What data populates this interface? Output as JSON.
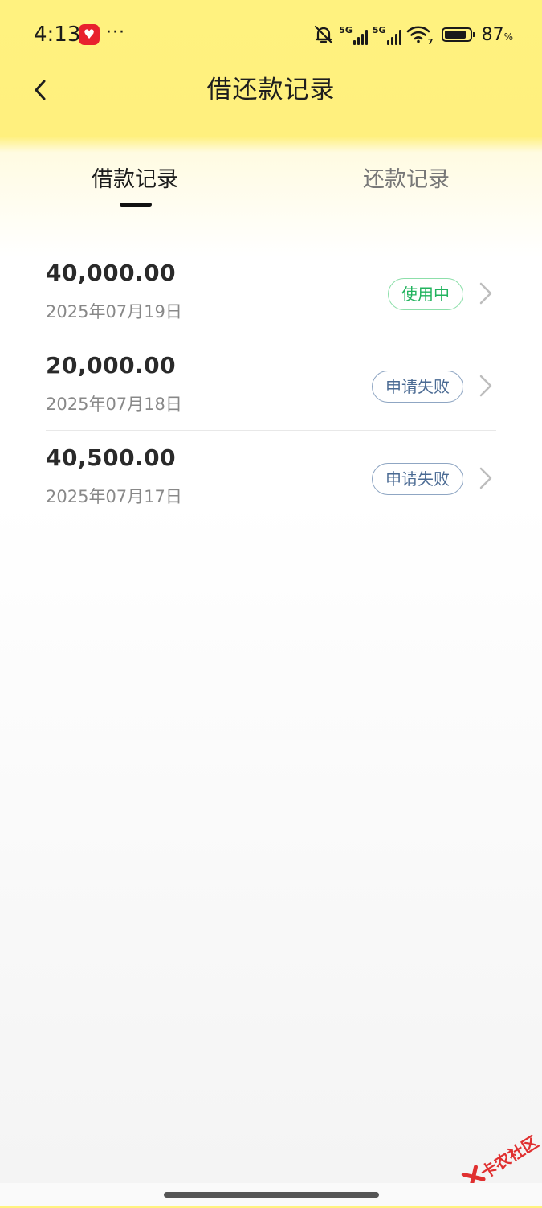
{
  "status_bar": {
    "time": "4:13",
    "dots": "···",
    "network_1": "5G",
    "network_2": "5G",
    "wifi_sub": "7",
    "battery_value": "87",
    "battery_unit": "%",
    "battery_level": 0.87
  },
  "header": {
    "title": "借还款记录"
  },
  "tabs": [
    {
      "label": "借款记录",
      "active": true
    },
    {
      "label": "还款记录",
      "active": false
    }
  ],
  "records": [
    {
      "amount": "40,000.00",
      "date": "2025年07月19日",
      "status": "使用中",
      "status_type": "active"
    },
    {
      "amount": "20,000.00",
      "date": "2025年07月18日",
      "status": "申请失败",
      "status_type": "failed"
    },
    {
      "amount": "40,500.00",
      "date": "2025年07月17日",
      "status": "申请失败",
      "status_type": "failed"
    }
  ],
  "watermark": {
    "text": "卡农社区"
  },
  "colors": {
    "header_yellow": "#fff27f",
    "status_active": "#22b35e",
    "status_failed": "#4a6a93",
    "watermark_red": "#e03030"
  }
}
